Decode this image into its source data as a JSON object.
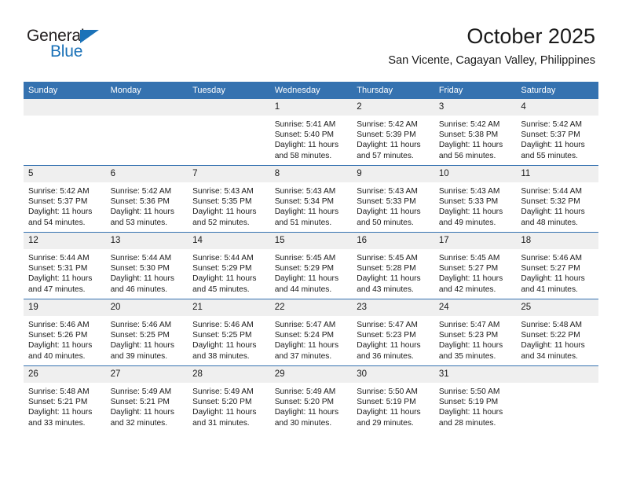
{
  "branding": {
    "name_top": "General",
    "name_bottom": "Blue",
    "accent_color": "#1b72b8"
  },
  "header": {
    "title": "October 2025",
    "subtitle": "San Vicente, Cagayan Valley, Philippines"
  },
  "theme": {
    "header_row_bg": "#3572b0",
    "daynum_bg": "#efefef",
    "text": "#1a1a1a"
  },
  "weekdays": [
    "Sunday",
    "Monday",
    "Tuesday",
    "Wednesday",
    "Thursday",
    "Friday",
    "Saturday"
  ],
  "weeks": [
    [
      {
        "day": "",
        "sunrise": "",
        "sunset": "",
        "daylight1": "",
        "daylight2": ""
      },
      {
        "day": "",
        "sunrise": "",
        "sunset": "",
        "daylight1": "",
        "daylight2": ""
      },
      {
        "day": "",
        "sunrise": "",
        "sunset": "",
        "daylight1": "",
        "daylight2": ""
      },
      {
        "day": "1",
        "sunrise": "Sunrise: 5:41 AM",
        "sunset": "Sunset: 5:40 PM",
        "daylight1": "Daylight: 11 hours",
        "daylight2": "and 58 minutes."
      },
      {
        "day": "2",
        "sunrise": "Sunrise: 5:42 AM",
        "sunset": "Sunset: 5:39 PM",
        "daylight1": "Daylight: 11 hours",
        "daylight2": "and 57 minutes."
      },
      {
        "day": "3",
        "sunrise": "Sunrise: 5:42 AM",
        "sunset": "Sunset: 5:38 PM",
        "daylight1": "Daylight: 11 hours",
        "daylight2": "and 56 minutes."
      },
      {
        "day": "4",
        "sunrise": "Sunrise: 5:42 AM",
        "sunset": "Sunset: 5:37 PM",
        "daylight1": "Daylight: 11 hours",
        "daylight2": "and 55 minutes."
      }
    ],
    [
      {
        "day": "5",
        "sunrise": "Sunrise: 5:42 AM",
        "sunset": "Sunset: 5:37 PM",
        "daylight1": "Daylight: 11 hours",
        "daylight2": "and 54 minutes."
      },
      {
        "day": "6",
        "sunrise": "Sunrise: 5:42 AM",
        "sunset": "Sunset: 5:36 PM",
        "daylight1": "Daylight: 11 hours",
        "daylight2": "and 53 minutes."
      },
      {
        "day": "7",
        "sunrise": "Sunrise: 5:43 AM",
        "sunset": "Sunset: 5:35 PM",
        "daylight1": "Daylight: 11 hours",
        "daylight2": "and 52 minutes."
      },
      {
        "day": "8",
        "sunrise": "Sunrise: 5:43 AM",
        "sunset": "Sunset: 5:34 PM",
        "daylight1": "Daylight: 11 hours",
        "daylight2": "and 51 minutes."
      },
      {
        "day": "9",
        "sunrise": "Sunrise: 5:43 AM",
        "sunset": "Sunset: 5:33 PM",
        "daylight1": "Daylight: 11 hours",
        "daylight2": "and 50 minutes."
      },
      {
        "day": "10",
        "sunrise": "Sunrise: 5:43 AM",
        "sunset": "Sunset: 5:33 PM",
        "daylight1": "Daylight: 11 hours",
        "daylight2": "and 49 minutes."
      },
      {
        "day": "11",
        "sunrise": "Sunrise: 5:44 AM",
        "sunset": "Sunset: 5:32 PM",
        "daylight1": "Daylight: 11 hours",
        "daylight2": "and 48 minutes."
      }
    ],
    [
      {
        "day": "12",
        "sunrise": "Sunrise: 5:44 AM",
        "sunset": "Sunset: 5:31 PM",
        "daylight1": "Daylight: 11 hours",
        "daylight2": "and 47 minutes."
      },
      {
        "day": "13",
        "sunrise": "Sunrise: 5:44 AM",
        "sunset": "Sunset: 5:30 PM",
        "daylight1": "Daylight: 11 hours",
        "daylight2": "and 46 minutes."
      },
      {
        "day": "14",
        "sunrise": "Sunrise: 5:44 AM",
        "sunset": "Sunset: 5:29 PM",
        "daylight1": "Daylight: 11 hours",
        "daylight2": "and 45 minutes."
      },
      {
        "day": "15",
        "sunrise": "Sunrise: 5:45 AM",
        "sunset": "Sunset: 5:29 PM",
        "daylight1": "Daylight: 11 hours",
        "daylight2": "and 44 minutes."
      },
      {
        "day": "16",
        "sunrise": "Sunrise: 5:45 AM",
        "sunset": "Sunset: 5:28 PM",
        "daylight1": "Daylight: 11 hours",
        "daylight2": "and 43 minutes."
      },
      {
        "day": "17",
        "sunrise": "Sunrise: 5:45 AM",
        "sunset": "Sunset: 5:27 PM",
        "daylight1": "Daylight: 11 hours",
        "daylight2": "and 42 minutes."
      },
      {
        "day": "18",
        "sunrise": "Sunrise: 5:46 AM",
        "sunset": "Sunset: 5:27 PM",
        "daylight1": "Daylight: 11 hours",
        "daylight2": "and 41 minutes."
      }
    ],
    [
      {
        "day": "19",
        "sunrise": "Sunrise: 5:46 AM",
        "sunset": "Sunset: 5:26 PM",
        "daylight1": "Daylight: 11 hours",
        "daylight2": "and 40 minutes."
      },
      {
        "day": "20",
        "sunrise": "Sunrise: 5:46 AM",
        "sunset": "Sunset: 5:25 PM",
        "daylight1": "Daylight: 11 hours",
        "daylight2": "and 39 minutes."
      },
      {
        "day": "21",
        "sunrise": "Sunrise: 5:46 AM",
        "sunset": "Sunset: 5:25 PM",
        "daylight1": "Daylight: 11 hours",
        "daylight2": "and 38 minutes."
      },
      {
        "day": "22",
        "sunrise": "Sunrise: 5:47 AM",
        "sunset": "Sunset: 5:24 PM",
        "daylight1": "Daylight: 11 hours",
        "daylight2": "and 37 minutes."
      },
      {
        "day": "23",
        "sunrise": "Sunrise: 5:47 AM",
        "sunset": "Sunset: 5:23 PM",
        "daylight1": "Daylight: 11 hours",
        "daylight2": "and 36 minutes."
      },
      {
        "day": "24",
        "sunrise": "Sunrise: 5:47 AM",
        "sunset": "Sunset: 5:23 PM",
        "daylight1": "Daylight: 11 hours",
        "daylight2": "and 35 minutes."
      },
      {
        "day": "25",
        "sunrise": "Sunrise: 5:48 AM",
        "sunset": "Sunset: 5:22 PM",
        "daylight1": "Daylight: 11 hours",
        "daylight2": "and 34 minutes."
      }
    ],
    [
      {
        "day": "26",
        "sunrise": "Sunrise: 5:48 AM",
        "sunset": "Sunset: 5:21 PM",
        "daylight1": "Daylight: 11 hours",
        "daylight2": "and 33 minutes."
      },
      {
        "day": "27",
        "sunrise": "Sunrise: 5:49 AM",
        "sunset": "Sunset: 5:21 PM",
        "daylight1": "Daylight: 11 hours",
        "daylight2": "and 32 minutes."
      },
      {
        "day": "28",
        "sunrise": "Sunrise: 5:49 AM",
        "sunset": "Sunset: 5:20 PM",
        "daylight1": "Daylight: 11 hours",
        "daylight2": "and 31 minutes."
      },
      {
        "day": "29",
        "sunrise": "Sunrise: 5:49 AM",
        "sunset": "Sunset: 5:20 PM",
        "daylight1": "Daylight: 11 hours",
        "daylight2": "and 30 minutes."
      },
      {
        "day": "30",
        "sunrise": "Sunrise: 5:50 AM",
        "sunset": "Sunset: 5:19 PM",
        "daylight1": "Daylight: 11 hours",
        "daylight2": "and 29 minutes."
      },
      {
        "day": "31",
        "sunrise": "Sunrise: 5:50 AM",
        "sunset": "Sunset: 5:19 PM",
        "daylight1": "Daylight: 11 hours",
        "daylight2": "and 28 minutes."
      },
      {
        "day": "",
        "sunrise": "",
        "sunset": "",
        "daylight1": "",
        "daylight2": ""
      }
    ]
  ]
}
